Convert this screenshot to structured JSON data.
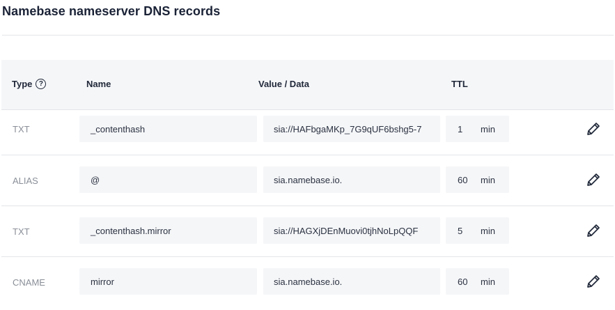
{
  "page": {
    "title": "Namebase nameserver DNS records"
  },
  "table": {
    "headers": {
      "type": "Type",
      "name": "Name",
      "value": "Value / Data",
      "ttl": "TTL",
      "help": "?"
    },
    "rows": [
      {
        "type": "TXT",
        "name": "_contenthash",
        "value": "sia://HAFbgaMKp_7G9qUF6bshg5-7",
        "ttl": "1",
        "unit": "min"
      },
      {
        "type": "ALIAS",
        "name": "@",
        "value": "sia.namebase.io.",
        "ttl": "60",
        "unit": "min"
      },
      {
        "type": "TXT",
        "name": "_contenthash.mirror",
        "value": "sia://HAGXjDEnMuovi0tjhNoLpQQF",
        "ttl": "5",
        "unit": "min"
      },
      {
        "type": "CNAME",
        "name": "mirror",
        "value": "sia.namebase.io.",
        "ttl": "60",
        "unit": "min"
      }
    ]
  },
  "icons": {
    "help": "question-circle-icon",
    "edit": "pencil-icon"
  },
  "colors": {
    "header_bg": "#f5f6f8",
    "field_bg": "#f5f6f8",
    "type_text": "#8a8f98",
    "divider": "#e3e5e8"
  }
}
